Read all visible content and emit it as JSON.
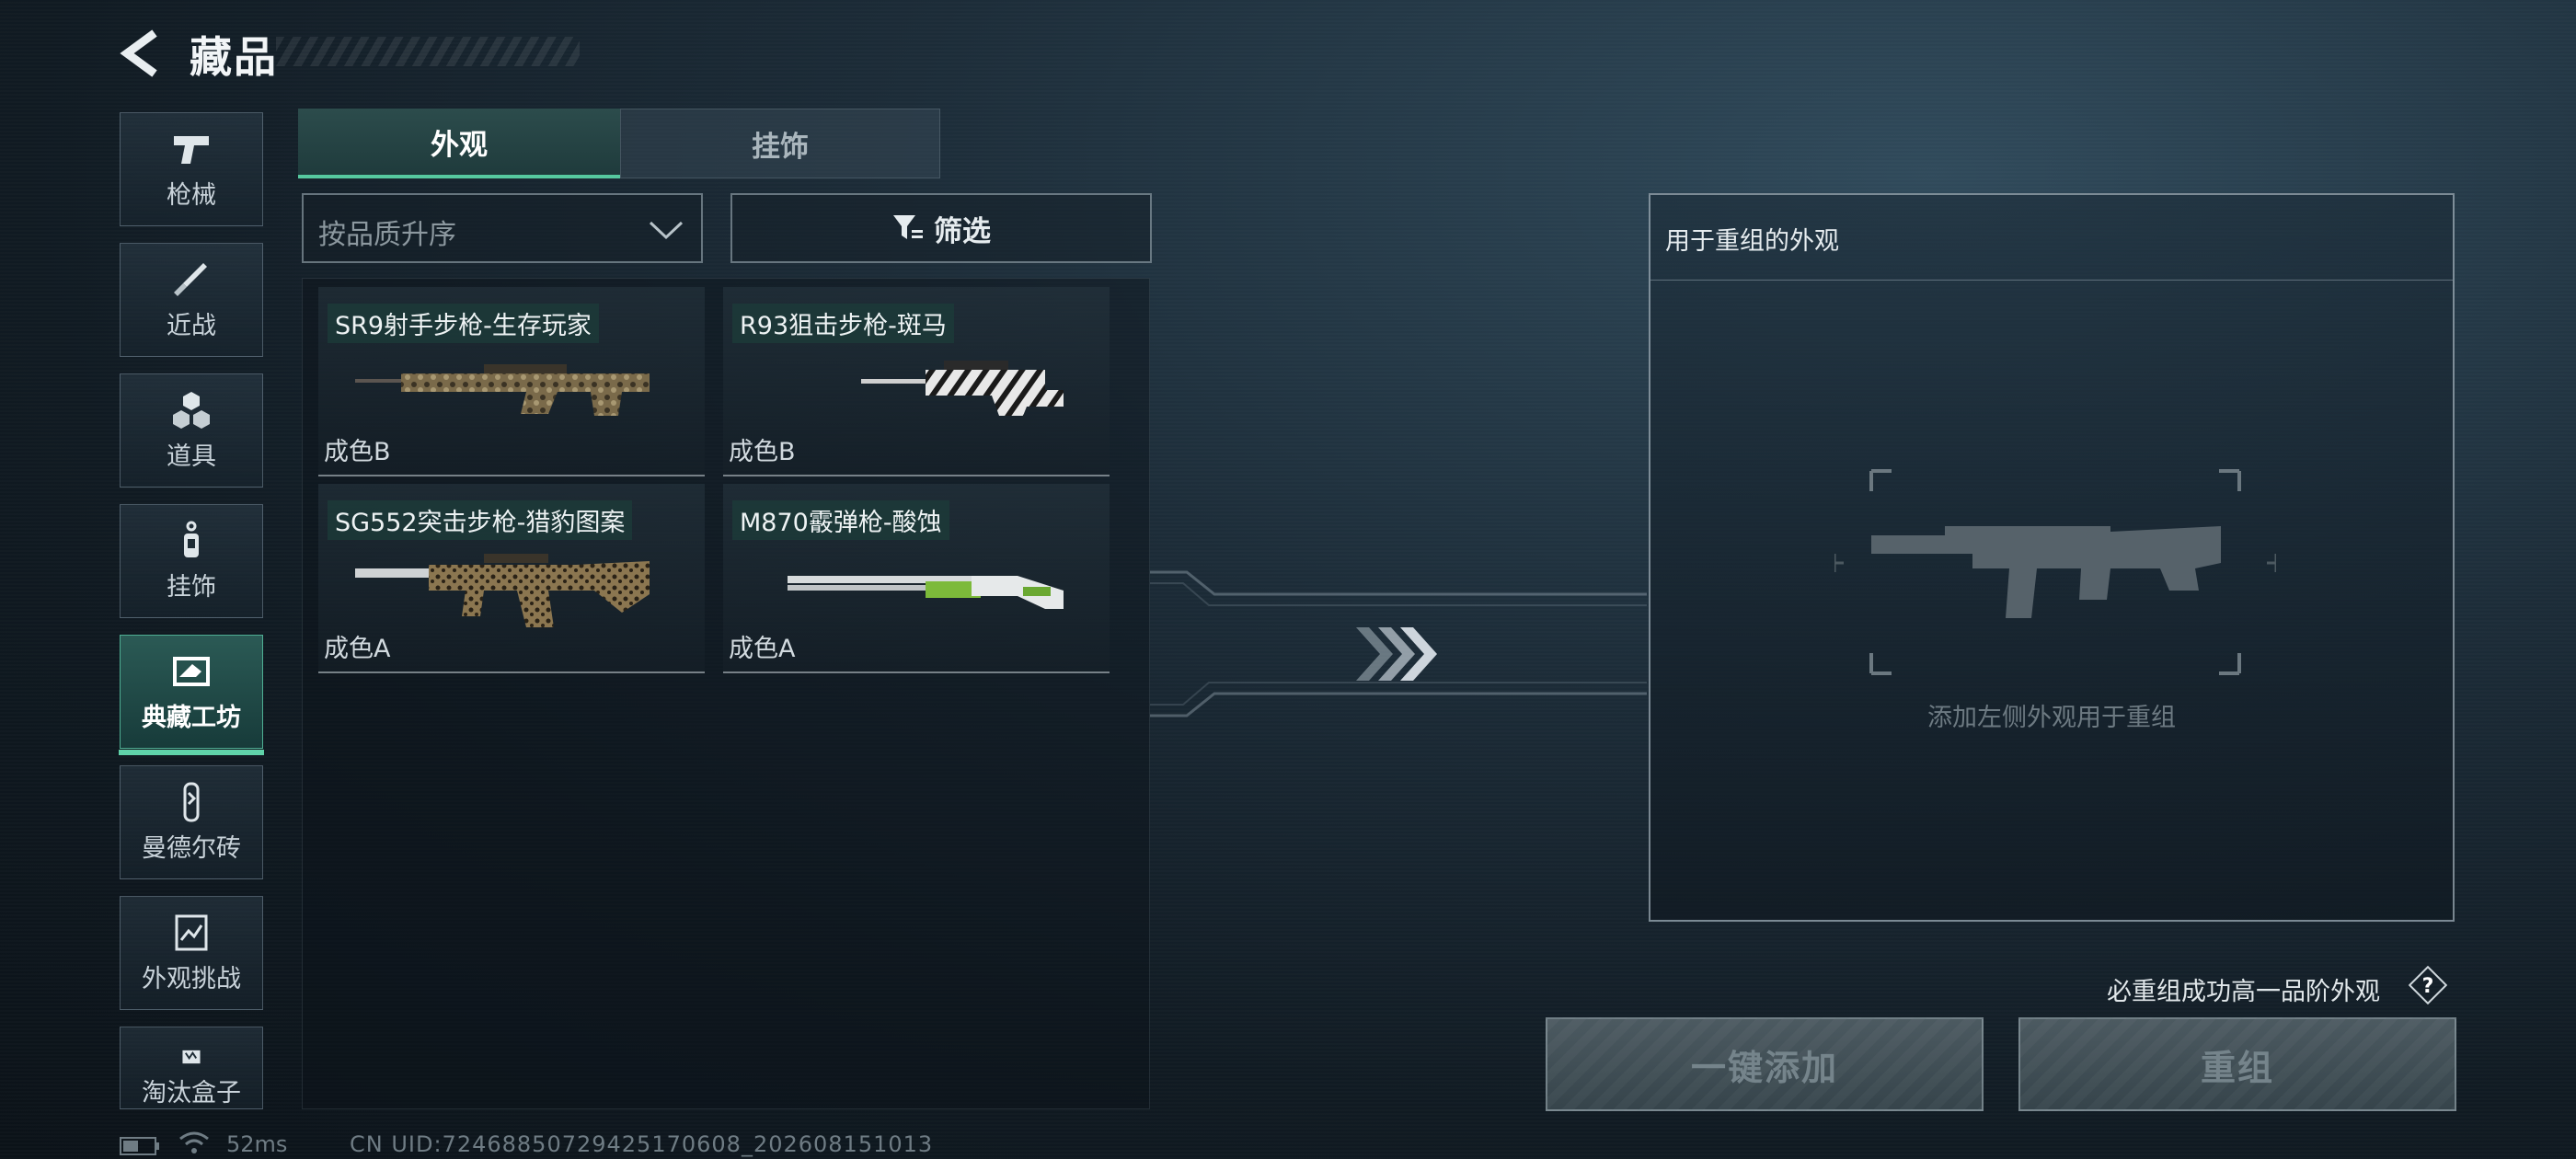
{
  "header": {
    "title": "藏品"
  },
  "sidebar": {
    "items": [
      {
        "label": "枪械",
        "icon": "pistol-icon"
      },
      {
        "label": "近战",
        "icon": "knife-icon"
      },
      {
        "label": "道具",
        "icon": "grenades-icon"
      },
      {
        "label": "挂饰",
        "icon": "charm-icon"
      },
      {
        "label": "典藏工坊",
        "icon": "workshop-icon",
        "active": true
      },
      {
        "label": "曼德尔砖",
        "icon": "brick-icon"
      },
      {
        "label": "外观挑战",
        "icon": "challenge-icon"
      },
      {
        "label": "淘汰盒子",
        "icon": "box-icon"
      }
    ]
  },
  "tabs": [
    {
      "label": "外观",
      "active": true
    },
    {
      "label": "挂饰",
      "active": false
    }
  ],
  "toolbar": {
    "sort_value": "按品质升序",
    "filter_label": "筛选"
  },
  "items": [
    {
      "name": "SR9射手步枪-生存玩家",
      "grade": "成色B",
      "skin": "camo"
    },
    {
      "name": "R93狙击步枪-斑马",
      "grade": "成色B",
      "skin": "zebra"
    },
    {
      "name": "SG552突击步枪-猎豹图案",
      "grade": "成色A",
      "skin": "leopard"
    },
    {
      "name": "M870霰弹枪-酸蚀",
      "grade": "成色A",
      "skin": "acid"
    }
  ],
  "recombine_panel": {
    "title": "用于重组的外观",
    "placeholder": "添加左侧外观用于重组"
  },
  "footer": {
    "guarantee_text": "必重组成功高一品阶外观",
    "add_all_label": "一键添加",
    "recombine_label": "重组"
  },
  "status": {
    "ping": "52ms",
    "uid": "CN UID:7246885072942517060​8_202608151013"
  },
  "colors": {
    "accent": "#5fd2a9",
    "active_tab": "#2c4c4c"
  }
}
